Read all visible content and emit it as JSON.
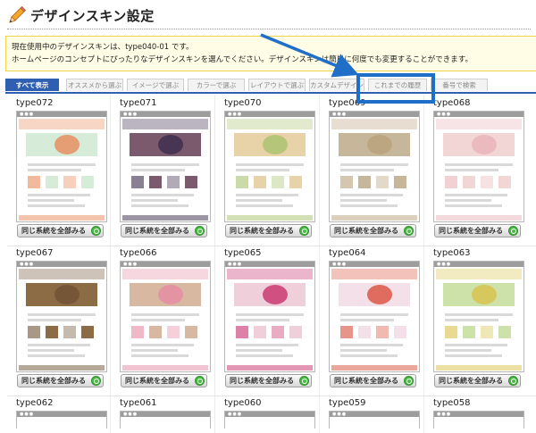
{
  "header": {
    "title": "デザインスキン設定",
    "icon": "pencil-icon"
  },
  "notice": {
    "line1": "現在使用中のデザインスキンは、type040-01 です。",
    "line2": "ホームページのコンセプトにぴったりなデザインスキンを選んでください。デザインスキンは簡単に何度でも変更することができます。"
  },
  "tabs": [
    {
      "label": "すべて表示",
      "active": true
    },
    {
      "label": "オススメから選ぶ",
      "active": false
    },
    {
      "label": "イメージで選ぶ",
      "active": false
    },
    {
      "label": "カラーで選ぶ",
      "active": false
    },
    {
      "label": "レイアウトで選ぶ",
      "active": false
    },
    {
      "label": "カスタムデザイン",
      "active": false
    },
    {
      "label": "これまでの履歴",
      "active": false,
      "highlighted": true
    },
    {
      "label": "番号で検索",
      "active": false
    }
  ],
  "skins": [
    {
      "name": "type072",
      "button_label": "同じ系統を全部みる",
      "accent": "#e98a5a",
      "hero": "#d7ecd8"
    },
    {
      "name": "type071",
      "button_label": "同じ系統を全部みる",
      "accent": "#3a2c4c",
      "hero": "#7c5a6e"
    },
    {
      "name": "type070",
      "button_label": "同じ系統を全部みる",
      "accent": "#a8c26d",
      "hero": "#e8d3a8"
    },
    {
      "name": "type069",
      "button_label": "同じ系統を全部みる",
      "accent": "#b9a07a",
      "hero": "#c7b79a"
    },
    {
      "name": "type068",
      "button_label": "同じ系統を全部みる",
      "accent": "#e9b3b9",
      "hero": "#f2d6d6"
    },
    {
      "name": "type067",
      "button_label": "同じ系統を全部みる",
      "accent": "#6f5334",
      "hero": "#8c6c44"
    },
    {
      "name": "type066",
      "button_label": "同じ系統を全部みる",
      "accent": "#e58aa3",
      "hero": "#d9b8a2"
    },
    {
      "name": "type065",
      "button_label": "同じ系統を全部みる",
      "accent": "#c72f6a",
      "hero": "#efd0da"
    },
    {
      "name": "type064",
      "button_label": "同じ系統を全部みる",
      "accent": "#d94f3b",
      "hero": "#f3e0e8"
    },
    {
      "name": "type063",
      "button_label": "同じ系統を全部みる",
      "accent": "#d9c24a",
      "hero": "#cde2a8"
    },
    {
      "name": "type062",
      "button_label": "",
      "accent": "",
      "hero": ""
    },
    {
      "name": "type061",
      "button_label": "",
      "accent": "",
      "hero": ""
    },
    {
      "name": "type060",
      "button_label": "",
      "accent": "",
      "hero": ""
    },
    {
      "name": "type059",
      "button_label": "",
      "accent": "",
      "hero": ""
    },
    {
      "name": "type058",
      "button_label": "",
      "accent": "",
      "hero": ""
    }
  ],
  "colors": {
    "tab_active": "#2f5fb0",
    "callout": "#1f6fc8",
    "notice_border": "#f0d34c",
    "button_icon": "#4cb848"
  }
}
